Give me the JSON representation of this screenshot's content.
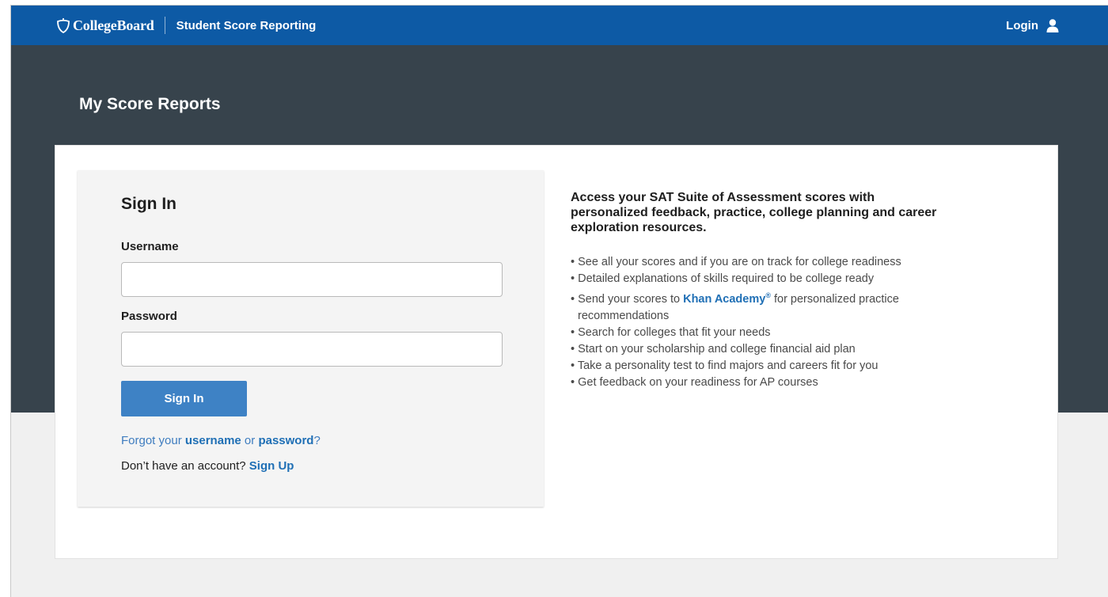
{
  "header": {
    "brand_name": "CollegeBoard",
    "app_name": "Student Score Reporting",
    "login_label": "Login"
  },
  "page": {
    "title": "My Score Reports"
  },
  "signin": {
    "title": "Sign In",
    "username_label": "Username",
    "username_value": "",
    "password_label": "Password",
    "password_value": "",
    "button_label": "Sign In",
    "forgot_prefix": "Forgot your ",
    "forgot_username": "username",
    "forgot_or": " or ",
    "forgot_password": "password",
    "forgot_suffix": "?",
    "no_account_text": "Don’t have an account? ",
    "signup_label": "Sign Up"
  },
  "info": {
    "heading": "Access your SAT Suite of Assessment scores with personalized feedback, practice, college planning and career exploration resources.",
    "features": [
      "• See all your scores and if you are on track for college readiness",
      "• Detailed explanations of skills required to be college ready",
      "• Search for colleges that fit your needs",
      "• Start on your scholarship and college financial aid plan",
      "• Take a personality test to find majors and careers fit for you",
      "• Get feedback on your readiness for AP courses"
    ],
    "khan_prefix": "• Send your scores to ",
    "khan_link": "Khan Academy",
    "khan_mark": "®",
    "khan_suffix": " for personalized practice recommendations"
  },
  "colors": {
    "topbar": "#0d5aa5",
    "hero": "#37434c",
    "button": "#3e82c5",
    "link": "#1f6fb5"
  },
  "icons": {
    "brand": "acorn-logo-icon",
    "login": "user-icon"
  }
}
